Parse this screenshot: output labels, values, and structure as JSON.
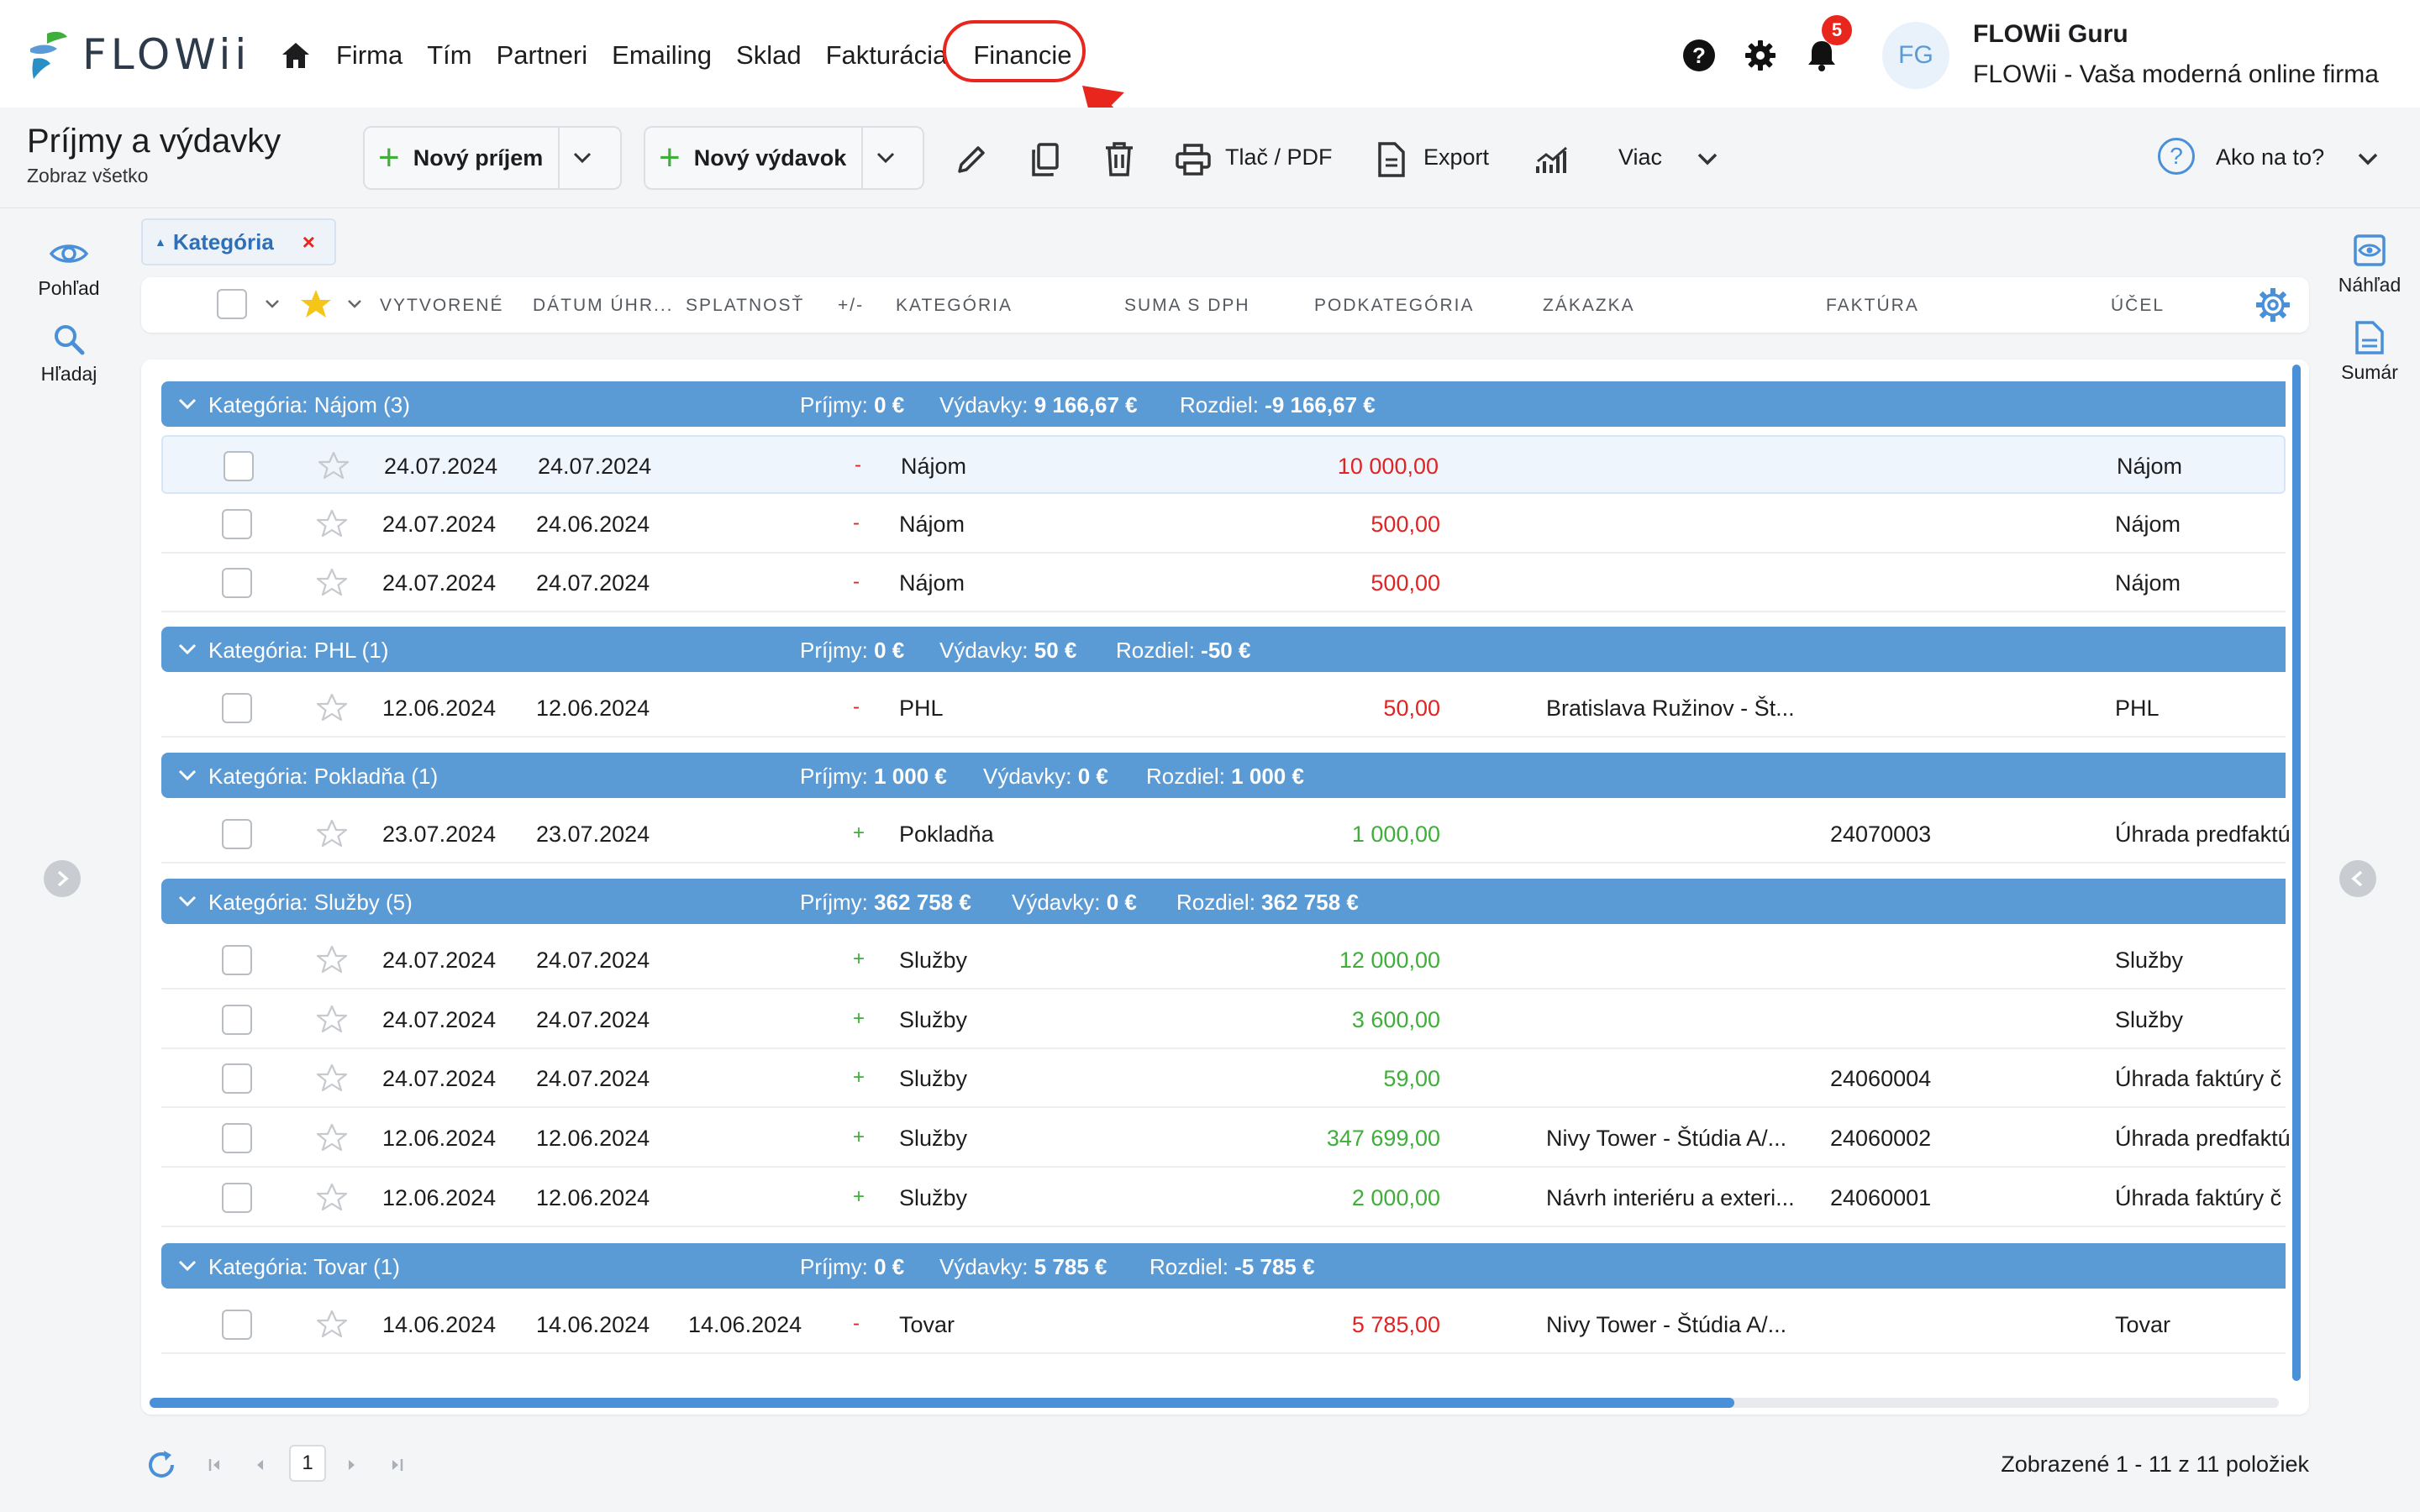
{
  "app": {
    "logo_text": "FLOWii",
    "nav": [
      "Firma",
      "Tím",
      "Partneri",
      "Emailing",
      "Sklad",
      "Fakturácia",
      "Financie"
    ],
    "notifications_count": "5",
    "user_initials": "FG",
    "user_name": "FLOWii Guru",
    "user_company": "FLOWii - Vaša moderná online firma"
  },
  "colors": {
    "accent": "#5b9bd5",
    "negative": "#e02424",
    "positive": "#3fae3a",
    "highlight": "#e8261d"
  },
  "toolbar": {
    "title": "Príjmy a výdavky",
    "subtitle": "Zobraz všetko",
    "new_income": "Nový príjem",
    "new_expense": "Nový výdavok",
    "print": "Tlač / PDF",
    "export": "Export",
    "more": "Viac",
    "how_to": "Ako na to?"
  },
  "sidebar_left": {
    "view": "Pohľad",
    "search": "Hľadaj"
  },
  "sidebar_right": {
    "preview": "Náhľad",
    "summary": "Sumár"
  },
  "filter": {
    "label": "Kategória",
    "remove": "×"
  },
  "columns": [
    "VYTVORENÉ",
    "DÁTUM ÚHR...",
    "SPLATNOSŤ",
    "+/-",
    "KATEGÓRIA",
    "SUMA S DPH",
    "PODKATEGÓRIA",
    "ZÁKAZKA",
    "FAKTÚRA",
    "ÚČEL"
  ],
  "groups": [
    {
      "name": "Kategória: Nájom (3)",
      "prijmy_label": "Príjmy:",
      "prijmy": "0 €",
      "vydavky_label": "Výdavky:",
      "vydavky": "9 166,67 €",
      "rozdiel_label": "Rozdiel:",
      "rozdiel": "-9 166,67 €",
      "rows": [
        {
          "vytvorene": "24.07.2024",
          "datum": "24.07.2024",
          "splatnost": "",
          "pm": "-",
          "kategoria": "Nájom",
          "suma": "10 000,00",
          "zakazka": "",
          "faktura": "",
          "ucel": "Nájom"
        },
        {
          "vytvorene": "24.07.2024",
          "datum": "24.06.2024",
          "splatnost": "",
          "pm": "-",
          "kategoria": "Nájom",
          "suma": "500,00",
          "zakazka": "",
          "faktura": "",
          "ucel": "Nájom"
        },
        {
          "vytvorene": "24.07.2024",
          "datum": "24.07.2024",
          "splatnost": "",
          "pm": "-",
          "kategoria": "Nájom",
          "suma": "500,00",
          "zakazka": "",
          "faktura": "",
          "ucel": "Nájom"
        }
      ]
    },
    {
      "name": "Kategória: PHL (1)",
      "prijmy_label": "Príjmy:",
      "prijmy": "0 €",
      "vydavky_label": "Výdavky:",
      "vydavky": "50 €",
      "rozdiel_label": "Rozdiel:",
      "rozdiel": "-50 €",
      "rows": [
        {
          "vytvorene": "12.06.2024",
          "datum": "12.06.2024",
          "splatnost": "",
          "pm": "-",
          "kategoria": "PHL",
          "suma": "50,00",
          "zakazka": "Bratislava Ružinov - Št...",
          "faktura": "",
          "ucel": "PHL"
        }
      ]
    },
    {
      "name": "Kategória: Pokladňa (1)",
      "prijmy_label": "Príjmy:",
      "prijmy": "1 000 €",
      "vydavky_label": "Výdavky:",
      "vydavky": "0 €",
      "rozdiel_label": "Rozdiel:",
      "rozdiel": "1 000 €",
      "rows": [
        {
          "vytvorene": "23.07.2024",
          "datum": "23.07.2024",
          "splatnost": "",
          "pm": "+",
          "kategoria": "Pokladňa",
          "suma": "1 000,00",
          "zakazka": "",
          "faktura": "24070003",
          "ucel": "Úhrada predfaktú"
        }
      ]
    },
    {
      "name": "Kategória: Služby (5)",
      "prijmy_label": "Príjmy:",
      "prijmy": "362 758 €",
      "vydavky_label": "Výdavky:",
      "vydavky": "0 €",
      "rozdiel_label": "Rozdiel:",
      "rozdiel": "362 758 €",
      "rows": [
        {
          "vytvorene": "24.07.2024",
          "datum": "24.07.2024",
          "splatnost": "",
          "pm": "+",
          "kategoria": "Služby",
          "suma": "12 000,00",
          "zakazka": "",
          "faktura": "",
          "ucel": "Služby"
        },
        {
          "vytvorene": "24.07.2024",
          "datum": "24.07.2024",
          "splatnost": "",
          "pm": "+",
          "kategoria": "Služby",
          "suma": "3 600,00",
          "zakazka": "",
          "faktura": "",
          "ucel": "Služby"
        },
        {
          "vytvorene": "24.07.2024",
          "datum": "24.07.2024",
          "splatnost": "",
          "pm": "+",
          "kategoria": "Služby",
          "suma": "59,00",
          "zakazka": "",
          "faktura": "24060004",
          "ucel": "Úhrada faktúry č"
        },
        {
          "vytvorene": "12.06.2024",
          "datum": "12.06.2024",
          "splatnost": "",
          "pm": "+",
          "kategoria": "Služby",
          "suma": "347 699,00",
          "zakazka": "Nivy Tower - Štúdia A/...",
          "faktura": "24060002",
          "ucel": "Úhrada predfaktú"
        },
        {
          "vytvorene": "12.06.2024",
          "datum": "12.06.2024",
          "splatnost": "",
          "pm": "+",
          "kategoria": "Služby",
          "suma": "2 000,00",
          "zakazka": "Návrh interiéru a exteri...",
          "faktura": "24060001",
          "ucel": "Úhrada faktúry č"
        }
      ]
    },
    {
      "name": "Kategória: Tovar (1)",
      "prijmy_label": "Príjmy:",
      "prijmy": "0 €",
      "vydavky_label": "Výdavky:",
      "vydavky": "5 785 €",
      "rozdiel_label": "Rozdiel:",
      "rozdiel": "-5 785 €",
      "rows": [
        {
          "vytvorene": "14.06.2024",
          "datum": "14.06.2024",
          "splatnost": "14.06.2024",
          "pm": "-",
          "kategoria": "Tovar",
          "suma": "5 785,00",
          "zakazka": "Nivy Tower - Štúdia A/...",
          "faktura": "",
          "ucel": "Tovar"
        }
      ]
    }
  ],
  "pagination": {
    "current_page": "1",
    "info": "Zobrazené 1 - 11 z 11 položiek"
  }
}
